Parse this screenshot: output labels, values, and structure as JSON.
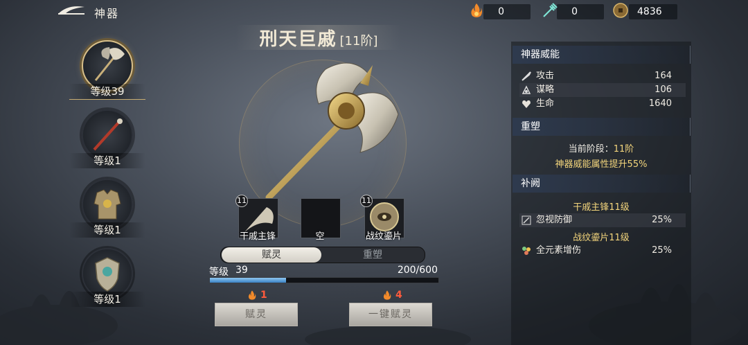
{
  "header": {
    "title": "神器",
    "resources": [
      {
        "icon": "flame-icon",
        "value": "0"
      },
      {
        "icon": "trident-icon",
        "value": "0"
      },
      {
        "icon": "coin-icon",
        "value": "4836"
      }
    ]
  },
  "artifacts": [
    {
      "label": "等级39",
      "icon": "battle-axe-icon",
      "selected": true
    },
    {
      "label": "等级1",
      "icon": "red-staff-icon",
      "selected": false
    },
    {
      "label": "等级1",
      "icon": "armor-icon",
      "selected": false
    },
    {
      "label": "等级1",
      "icon": "shield-icon",
      "selected": false
    }
  ],
  "weapon": {
    "name": "刑天巨戚",
    "stage": "[11阶]"
  },
  "gems": [
    {
      "level": "11",
      "label": "干戚主锋",
      "filled": true
    },
    {
      "level": "",
      "label": "空",
      "filled": false
    },
    {
      "level": "11",
      "label": "战纹鎏片",
      "filled": true
    }
  ],
  "tabs": {
    "active": "赋灵",
    "inactive": "重塑"
  },
  "level": {
    "label": "等级",
    "value": "39",
    "progress_text": "200/600",
    "progress": 0.333
  },
  "actions": {
    "left": {
      "cost": "1",
      "label": "赋灵"
    },
    "right": {
      "cost": "4",
      "label": "一键赋灵"
    }
  },
  "panel": {
    "power": {
      "title": "神器威能",
      "stats": [
        {
          "icon": "sword-icon",
          "name": "攻击",
          "value": "164"
        },
        {
          "icon": "strategy-icon",
          "name": "谋略",
          "value": "106"
        },
        {
          "icon": "heart-icon",
          "name": "生命",
          "value": "1640"
        }
      ]
    },
    "reforge": {
      "title": "重塑",
      "stage_label": "当前阶段：",
      "stage_value": "11阶",
      "bonus": "神器威能属性提升55%"
    },
    "supplement": {
      "title": "补阙",
      "groups": [
        {
          "name": "干戚主锋11级",
          "effect_icon": "pierce-icon",
          "effect": "忽视防御",
          "value": "25%"
        },
        {
          "name": "战纹鎏片11级",
          "effect_icon": "elements-icon",
          "effect": "全元素增伤",
          "value": "25%"
        }
      ]
    }
  },
  "colors": {
    "accent_gold": "#f3d57c",
    "cost_red": "#ff5a3c",
    "progress_blue": "#3a82c4"
  }
}
